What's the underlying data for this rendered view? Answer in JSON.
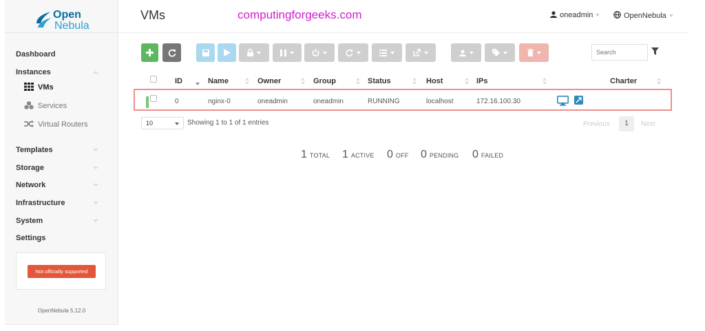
{
  "app": {
    "logo_line1": "Open",
    "logo_line2": "Nebula",
    "version": "OpenNebula 5.12.0",
    "support_badge": "Not officially supported"
  },
  "header": {
    "title": "VMs",
    "watermark": "computingforgeeks.com",
    "user": "oneadmin",
    "zone": "OpenNebula"
  },
  "sidebar": {
    "dashboard": "Dashboard",
    "instances": "Instances",
    "sub_vms": "VMs",
    "sub_services": "Services",
    "sub_vrouters": "Virtual Routers",
    "templates": "Templates",
    "storage": "Storage",
    "network": "Network",
    "infrastructure": "Infrastructure",
    "system": "System",
    "settings": "Settings"
  },
  "toolbar": {
    "search_placeholder": "Search"
  },
  "table": {
    "columns": [
      "ID",
      "Name",
      "Owner",
      "Group",
      "Status",
      "Host",
      "IPs",
      "Charter"
    ],
    "rows": [
      {
        "id": "0",
        "name": "nginx-0",
        "owner": "oneadmin",
        "group": "oneadmin",
        "status": "RUNNING",
        "host": "localhost",
        "ips": "172.16.100.30"
      }
    ],
    "per_page": "10",
    "showing": "Showing 1 to 1 of 1 entries",
    "prev": "Previous",
    "page": "1",
    "next": "Next"
  },
  "summary": {
    "total_n": "1",
    "total_l": "TOTAL",
    "active_n": "1",
    "active_l": "ACTIVE",
    "off_n": "0",
    "off_l": "OFF",
    "pending_n": "0",
    "pending_l": "PENDING",
    "failed_n": "0",
    "failed_l": "FAILED"
  },
  "colors": {
    "accent_green": "#5cb85c",
    "accent_blue": "#2c9fd4",
    "danger": "#e2573a",
    "highlight": "#ee8d8d"
  }
}
